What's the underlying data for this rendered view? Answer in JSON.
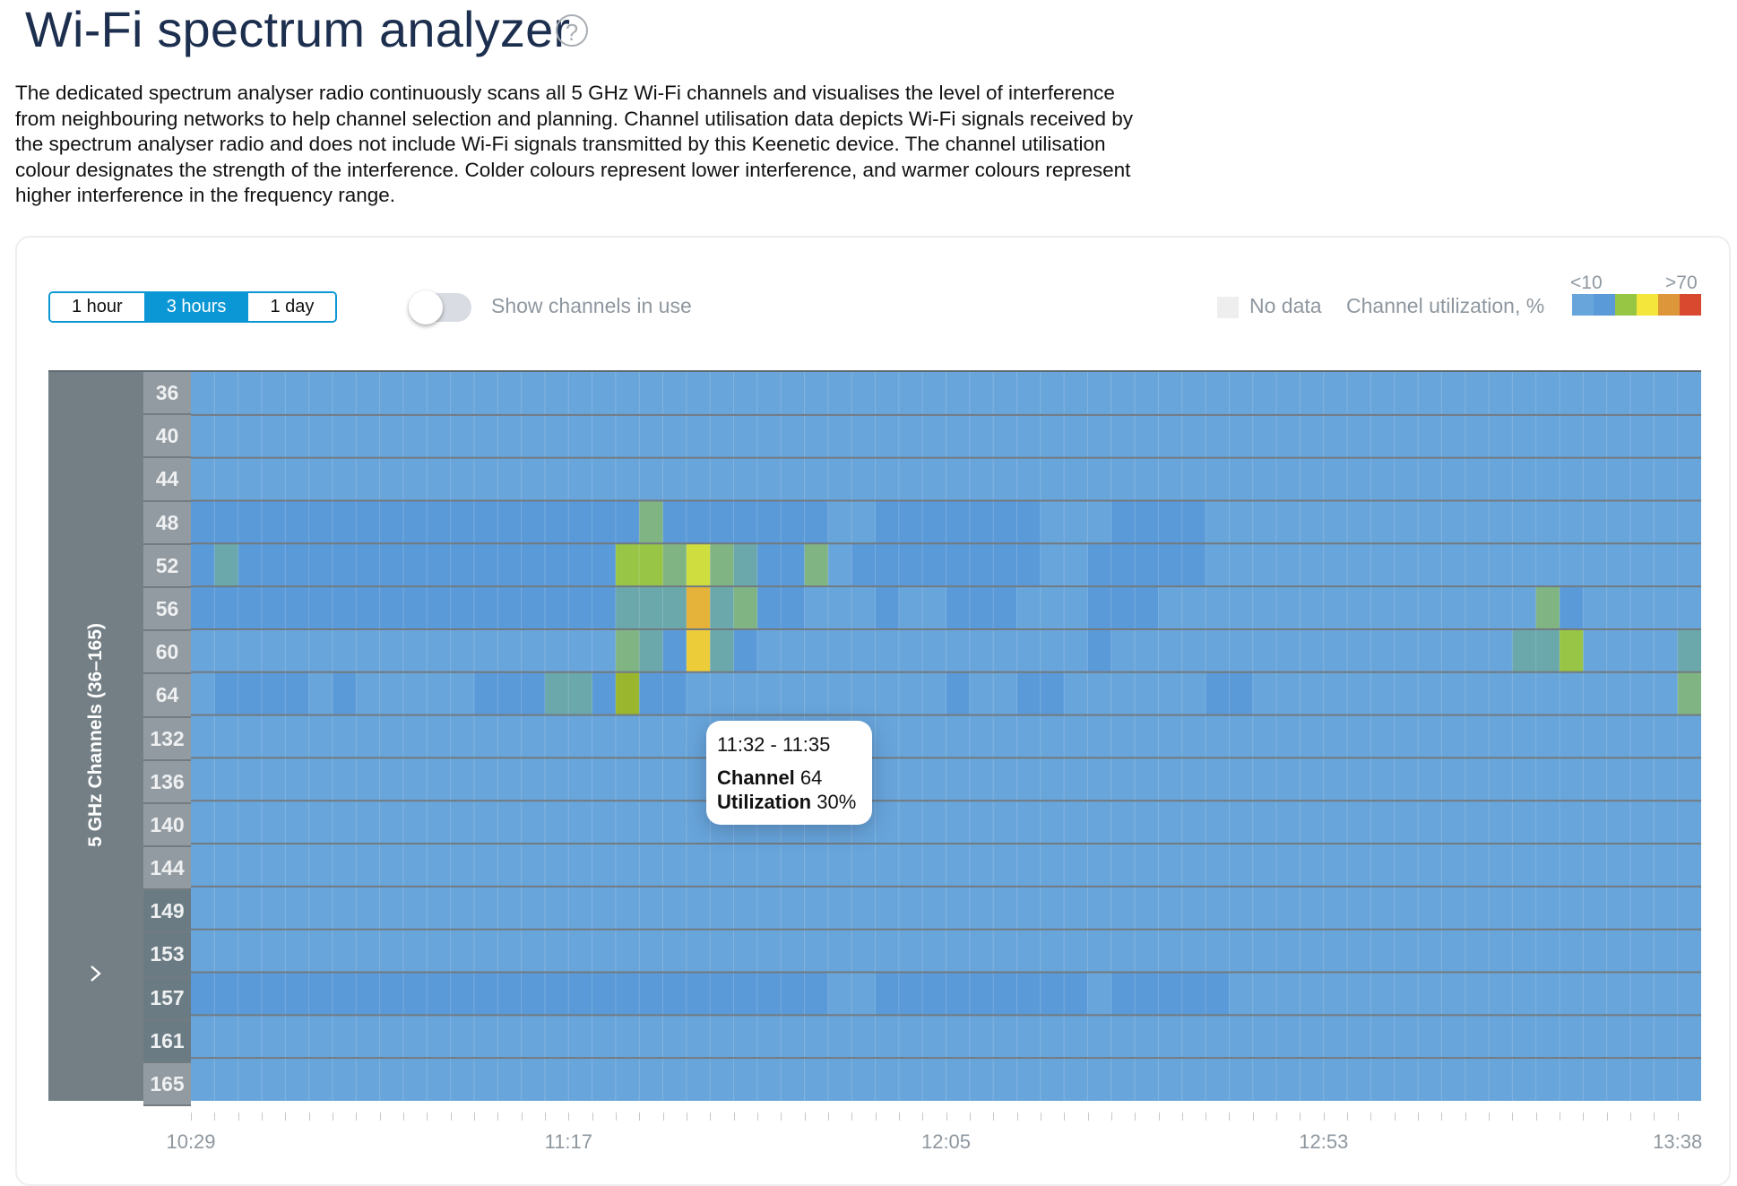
{
  "page": {
    "title": "Wi-Fi spectrum analyzer",
    "help_icon": "question-circle-icon",
    "description": "The dedicated spectrum analyser radio continuously scans all 5 GHz Wi-Fi channels and visualises the level of interference from neighbouring networks to help channel selection and planning. Channel utilisation data depicts Wi-Fi signals received by the spectrum analyser radio and does not include Wi-Fi signals transmitted by this Keenetic device. The channel utilisation colour designates the strength of the interference. Colder colours represent lower interference, and warmer colours represent higher interference in the frequency range."
  },
  "controls": {
    "range_options": [
      {
        "label": "1 hour",
        "active": false
      },
      {
        "label": "3 hours",
        "active": true
      },
      {
        "label": "1 day",
        "active": false
      }
    ],
    "toggle_label": "Show channels in use",
    "toggle_on": false
  },
  "legend": {
    "no_data_label": "No data",
    "no_data_color": "#eeeeee",
    "utilization_label": "Channel utilization, %",
    "scale_low": "<10",
    "scale_high": ">70",
    "scale_colors": [
      "#68a5db",
      "#5a9ad8",
      "#97c544",
      "#f5e63c",
      "#dd9639",
      "#d9492f"
    ]
  },
  "tooltip": {
    "time_range": "11:32 - 11:35",
    "channel_label": "Channel",
    "channel_value": "64",
    "utilization_label": "Utilization",
    "utilization_value": "30%"
  },
  "chart_data": {
    "type": "heatmap",
    "title": "",
    "ylabel": "5 GHz Channels (36–165)",
    "xlabel": "",
    "x_tick_labels": [
      "10:29",
      "11:17",
      "12:05",
      "12:53",
      "13:38"
    ],
    "x_range": [
      "10:29",
      "13:38"
    ],
    "interval_minutes": 3,
    "columns": 64,
    "channels": [
      "36",
      "40",
      "44",
      "48",
      "52",
      "56",
      "60",
      "64",
      "132",
      "136",
      "140",
      "144",
      "149",
      "153",
      "157",
      "161",
      "165"
    ],
    "dark_label_channels": [
      "149",
      "153",
      "157",
      "161"
    ],
    "level_colors": {
      "a": "#68a5db",
      "b": "#5a9ad8",
      "t": "#6aa8ab",
      "g": "#80b583",
      "G": "#98c545",
      "Y": "#d0dd3e",
      "y": "#edcc3a",
      "o": "#e5b23a",
      "l": "#9ab52e"
    },
    "level_meaning": {
      "a": "<10%",
      "b": "10-20%",
      "t": "~20%",
      "g": "~25%",
      "G": "~30-35%",
      "Y": "~45%",
      "y": "~50%",
      "o": "~60%",
      "l": "~30%"
    },
    "rows": [
      "aaaaaaaaaaaaaaaaaaaaaaaaaaaaaaaaaaaaaaaaaaaaaaaaaaaaaaaaaaaaaaaa",
      "aaaaaaaaaaaaaaaaaaaaaaaaaaaaaaaaaaaaaaaaaaaaaaaaaaaaaaaaaaaaaaaa",
      "aaaaaaaaaaaaaaaaaaaaaaaaaaaaaaaaaaaaaaaaaaaaaaaaaaaaaaaaaaaaaaaa",
      "bbbbbbbbbbbbbbbbbbbgbbbbbbbaabbbbbbbaaabbbbaaaaaaaaaaaaaaaaaaaaa",
      "btbbbbbbbbbbbbbbbbGGgYgtbbgabbbbbbbbaabbbbbaaaaaaaaaaaaaaaaaaaaa",
      "bbbbbbbbbbbbbbbbbbtttotgbbaaabaabbbaaabbbaaaaaaaaaaaaaaaagbaaaaagb",
      "aaaaaaaaaaaaaaaaaagtbytbaaaaaaaaaaaaaabaaaaaaaaaaaaaaaaattGaaaatb",
      "abbbbabaaaaabbbttblbbaaaaaaaaaaabaabbaaaaaabbaaaaaaaaaaaaaaaaaagb",
      "aaaaaaaaaaaaaaaaaaaaaaaaaaaaaaaaaaaaaaaaaaaaaaaaaaaaaaaaaaaaaaaa",
      "aaaaaaaaaaaaaaaaaaaaaaaaaaaaaaaaaaaaaaaaaaaaaaaaaaaaaaaaaaaaaaaa",
      "aaaaaaaaaaaaaaaaaaaaaaaaaaaaaaaaaaaaaaaaaaaaaaaaaaaaaaaaaaaaaaaa",
      "aaaaaaaaaaaaaaaaaaaaaaaaaaaaaaaaaaaaaaaaaaaaaaaaaaaaaaaaaaaaaaaa",
      "aaaaaaaaaaaaaaaaaaaaaaaaaaaaaaaaaaaaaaaaaaaaaaaaaaaaaaaaaaaaaaaa",
      "aaaaaaaaaaaaaaaaaaaaaaaaaaaaaaaaaaaaaaaaaaaaaaaaaaaaaaaaaaaaaaaa",
      "bbbbbbbbbbbbbbbbbbbbbbbbbbbaabbbbbbbbbabbbbbaaaaaaaaaaaaaaaaaaaa",
      "aaaaaaaaaaaaaaaaaaaaaaaaaaaaaaaaaaaaaaaaaaaaaaaaaaaaaaaaaaaaaaaa",
      "aaaaaaaaaaaaaaaaaaaaaaaaaaaaaaaaaaaaaaaaaaaaaaaaaaaaaaaaaaaaaaaa"
    ]
  }
}
